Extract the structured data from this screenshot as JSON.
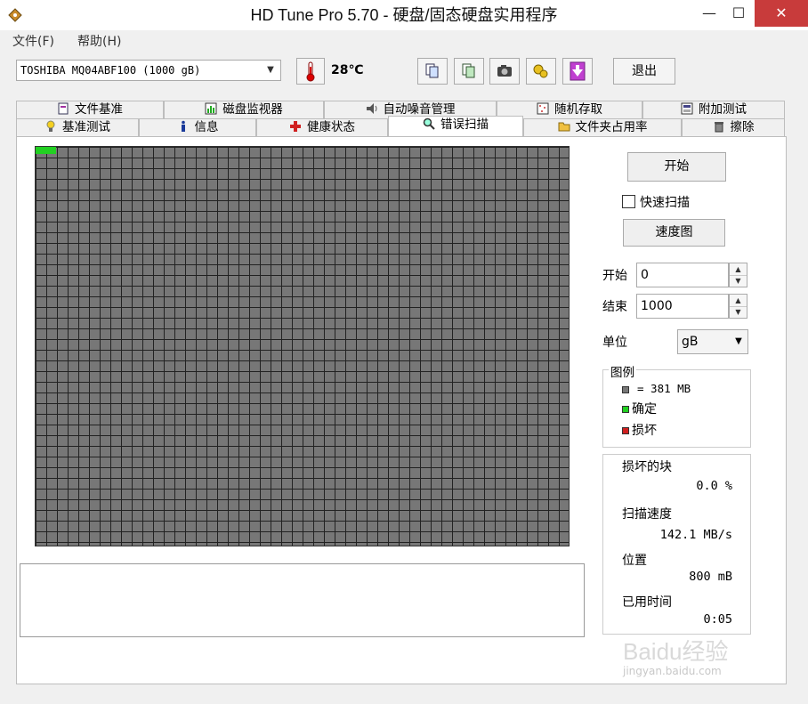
{
  "window": {
    "title": "HD Tune Pro 5.70 - 硬盘/固态硬盘实用程序",
    "minimize": "—",
    "maximize": "☐",
    "close": "✕"
  },
  "menu": {
    "file": "文件(F)",
    "help": "帮助(H)"
  },
  "toolbar": {
    "drive": "TOSHIBA MQ04ABF100 (1000 gB)",
    "temperature": "28℃",
    "exit_label": "退出"
  },
  "tabs_top": [
    {
      "label": "文件基准",
      "icon": "file-benchmark-icon"
    },
    {
      "label": "磁盘监视器",
      "icon": "disk-monitor-icon"
    },
    {
      "label": "自动噪音管理",
      "icon": "speaker-icon"
    },
    {
      "label": "随机存取",
      "icon": "random-access-icon"
    },
    {
      "label": "附加测试",
      "icon": "extra-tests-icon"
    }
  ],
  "tabs_bottom": [
    {
      "label": "基准测试",
      "icon": "benchmark-icon"
    },
    {
      "label": "信息",
      "icon": "info-icon"
    },
    {
      "label": "健康状态",
      "icon": "health-icon"
    },
    {
      "label": "错误扫描",
      "icon": "magnifier-icon"
    },
    {
      "label": "文件夹占用率",
      "icon": "folder-icon"
    },
    {
      "label": "擦除",
      "icon": "trash-icon"
    }
  ],
  "scan": {
    "start_button": "开始",
    "quick_scan": "快速扫描",
    "speed_map_button": "速度图",
    "start_label": "开始",
    "start_value": "0",
    "end_label": "结束",
    "end_value": "1000",
    "unit_label": "单位",
    "unit_value": "gB"
  },
  "legend": {
    "title": "图例",
    "block_size": "= 381 MB",
    "ok": "确定",
    "bad": "损坏",
    "colors": {
      "block": "#777777",
      "ok": "#22d022",
      "bad": "#d02020"
    }
  },
  "stats": {
    "damaged_label": "损坏的块",
    "damaged_value": "0.0 %",
    "speed_label": "扫描速度",
    "speed_value": "142.1 MB/s",
    "position_label": "位置",
    "position_value": "800 mB",
    "elapsed_label": "已用时间",
    "elapsed_value": "0:05"
  },
  "watermark": {
    "brand": "Baidu经验",
    "url": "jingyan.baidu.com"
  }
}
